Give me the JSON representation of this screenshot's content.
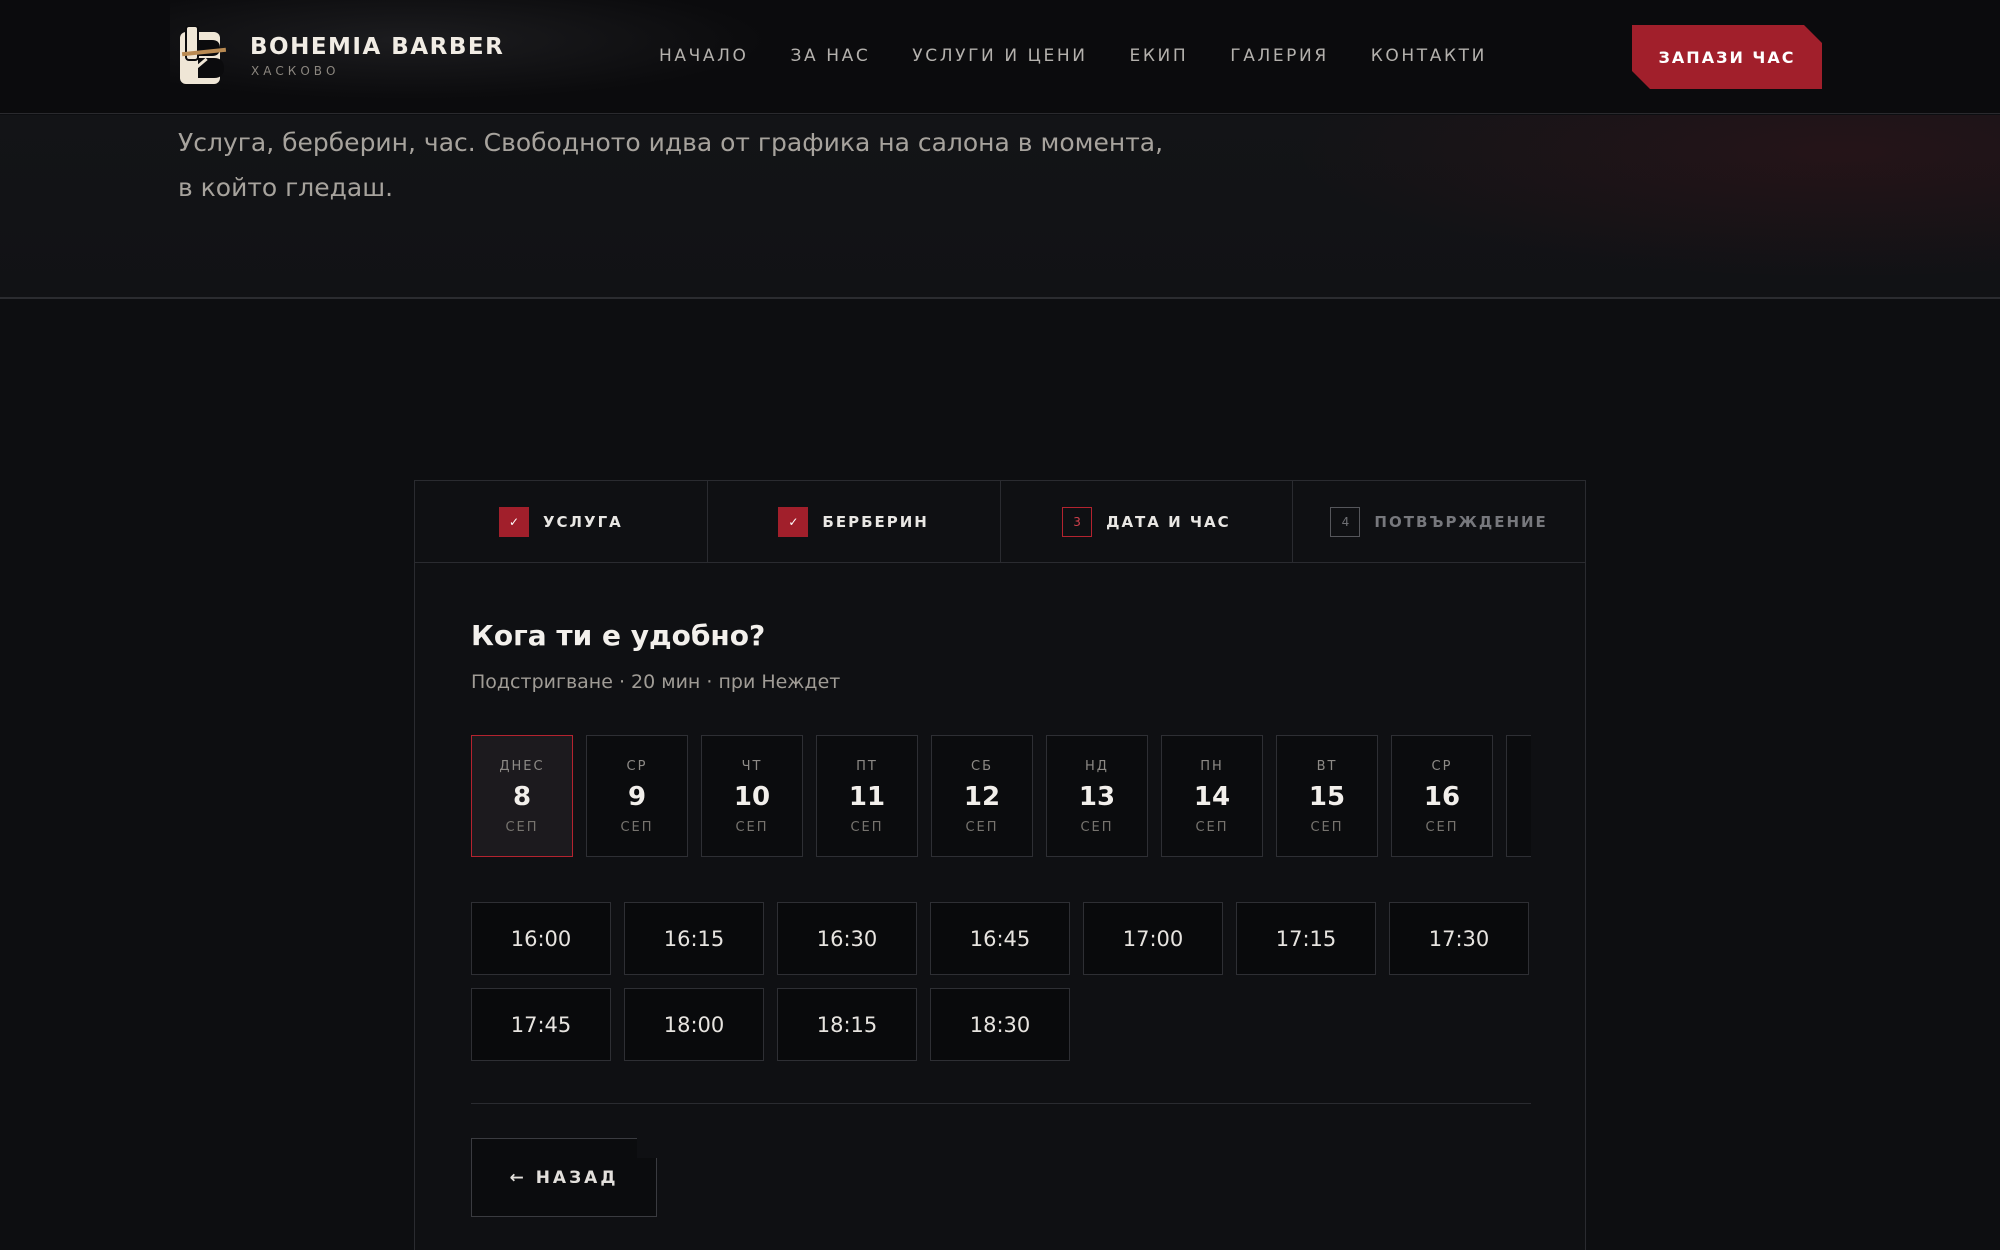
{
  "header": {
    "brand_name": "BOHEMIA BARBER",
    "brand_city": "ХАСКОВО",
    "nav": [
      "НАЧАЛО",
      "ЗА НАС",
      "УСЛУГИ И ЦЕНИ",
      "ЕКИП",
      "ГАЛЕРИЯ",
      "КОНТАКТИ"
    ],
    "cta_label": "ЗАПАЗИ ЧАС"
  },
  "intro": {
    "text": "Услуга, берберин, час. Свободното идва от графика на салона в момента, в който гледаш."
  },
  "steps": [
    {
      "marker": "✓",
      "label": "УСЛУГА",
      "state": "done"
    },
    {
      "marker": "✓",
      "label": "БЕРБЕРИН",
      "state": "done"
    },
    {
      "marker": "3",
      "label": "ДАТА И ЧАС",
      "state": "current"
    },
    {
      "marker": "4",
      "label": "ПОТВЪРЖДЕНИЕ",
      "state": "todo"
    }
  ],
  "booking": {
    "title": "Кога ти е удобно?",
    "subtitle": "Подстригване · 20 мин · при Неждет",
    "days": [
      {
        "dow": "ДНЕС",
        "num": "8",
        "mon": "СЕП",
        "selected": true
      },
      {
        "dow": "СР",
        "num": "9",
        "mon": "СЕП"
      },
      {
        "dow": "ЧТ",
        "num": "10",
        "mon": "СЕП"
      },
      {
        "dow": "ПТ",
        "num": "11",
        "mon": "СЕП"
      },
      {
        "dow": "СБ",
        "num": "12",
        "mon": "СЕП"
      },
      {
        "dow": "НД",
        "num": "13",
        "mon": "СЕП"
      },
      {
        "dow": "ПН",
        "num": "14",
        "mon": "СЕП"
      },
      {
        "dow": "ВТ",
        "num": "15",
        "mon": "СЕП"
      },
      {
        "dow": "СР",
        "num": "16",
        "mon": "СЕП"
      },
      {
        "dow": "",
        "num": "",
        "mon": ""
      }
    ],
    "slots": [
      "16:00",
      "16:15",
      "16:30",
      "16:45",
      "17:00",
      "17:15",
      "17:30",
      "17:45",
      "18:00",
      "18:15",
      "18:30"
    ],
    "back_label": "← НАЗАД"
  },
  "colors": {
    "accent": "#a11f2b",
    "background": "#0d0e11"
  }
}
